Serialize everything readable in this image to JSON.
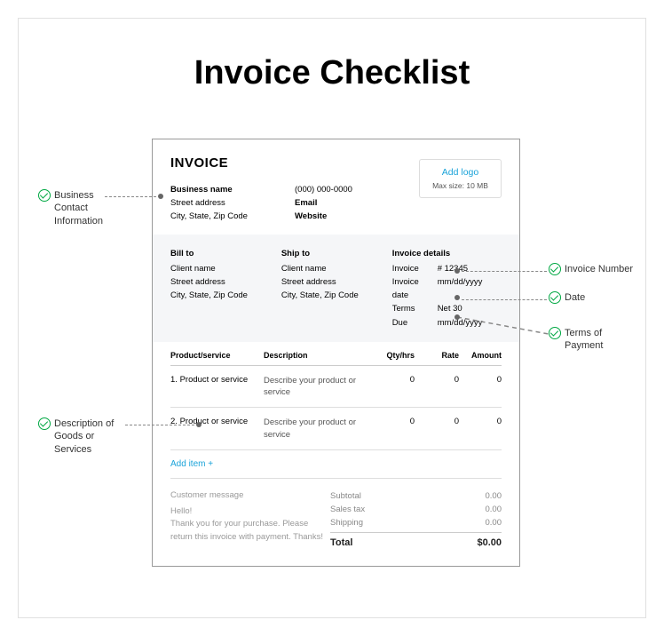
{
  "page_title": "Invoice Checklist",
  "invoice": {
    "heading": "INVOICE",
    "business": {
      "name": "Business name",
      "street": "Street address",
      "city": "City, State, Zip Code",
      "phone": "(000) 000-0000",
      "email": "Email",
      "website": "Website"
    },
    "logo": {
      "label": "Add logo",
      "sub": "Max size: 10 MB"
    },
    "bill_to": {
      "head": "Bill to",
      "name": "Client name",
      "street": "Street address",
      "city": "City, State, Zip Code"
    },
    "ship_to": {
      "head": "Ship to",
      "name": "Client name",
      "street": "Street address",
      "city": "City, State, Zip Code"
    },
    "details": {
      "head": "Invoice details",
      "inv_label": "Invoice",
      "inv_value": "# 12345",
      "date_label": "Invoice date",
      "date_value": "mm/dd/yyyy",
      "terms_label": "Terms",
      "terms_value": "Net 30",
      "due_label": "Due",
      "due_value": "mm/dd/yyyy"
    },
    "columns": {
      "prod": "Product/service",
      "desc": "Description",
      "qty": "Qty/hrs",
      "rate": "Rate",
      "amt": "Amount"
    },
    "items": [
      {
        "num": "1.",
        "prod": "Product or service",
        "desc": "Describe your product or service",
        "qty": "0",
        "rate": "0",
        "amt": "0"
      },
      {
        "num": "2.",
        "prod": "Product or service",
        "desc": "Describe your product or service",
        "qty": "0",
        "rate": "0",
        "amt": "0"
      }
    ],
    "add_item": "Add item +",
    "message": {
      "head": "Customer message",
      "body": "Hello!\nThank you for your purchase. Please return this invoice with payment. Thanks!"
    },
    "totals": {
      "subtotal_label": "Subtotal",
      "subtotal": "0.00",
      "tax_label": "Sales tax",
      "tax": "0.00",
      "ship_label": "Shipping",
      "ship": "0.00",
      "total_label": "Total",
      "total": "$0.00"
    }
  },
  "annotations": {
    "biz": "Business Contact Information",
    "num": "Invoice Number",
    "date": "Date",
    "terms": "Terms of Payment",
    "desc": "Description of Goods or Services"
  }
}
